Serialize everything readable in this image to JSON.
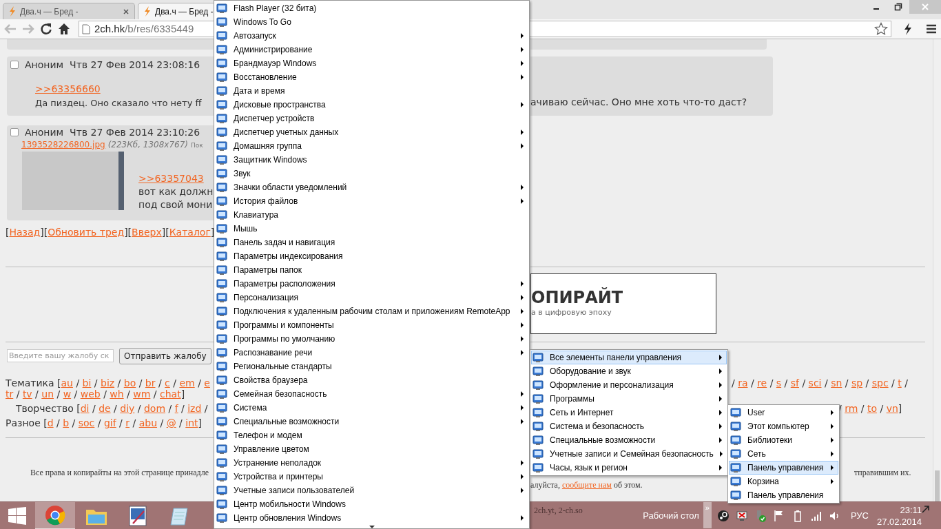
{
  "browser": {
    "tabs": [
      {
        "title": "Два.ч — Бред -",
        "selected": false,
        "closable": true
      },
      {
        "title": "Два.ч — Бред -",
        "selected": true,
        "closable": false
      }
    ],
    "address": {
      "host": "2ch.hk",
      "path": "/b/res/6335449"
    }
  },
  "page": {
    "post_1": {
      "checked": false,
      "author": "Аноним",
      "date": "Чтв 27 Фев 2014 23:08:16",
      "reply_link": ">>63356660",
      "text_left": "Да пиздец. Оно сказало что нету ff",
      "text_right": "ачиваю сейчас. Оно мне хоть что-то даст?"
    },
    "post_2": {
      "checked": false,
      "author": "Аноним",
      "date": "Чтв 27 Фев 2014 23:10:26",
      "file_link": "1393528226800.jpg",
      "file_info": "(223Кб, 1308x767)",
      "file_action": "Пок",
      "reply_link": ">>63357043",
      "text_lines": [
        "вот как должн",
        "под свой мони"
      ]
    },
    "nav": [
      {
        "text": "["
      },
      {
        "link": "Назад"
      },
      {
        "text": "]["
      },
      {
        "link": "Обновить тред"
      },
      {
        "text": "]["
      },
      {
        "link": "Вверх"
      },
      {
        "text": "]["
      },
      {
        "link": "Каталог"
      },
      {
        "text": "]"
      }
    ],
    "ad": {
      "title": "ОПИРАЙТ",
      "subtitle": "а в цифровую эпоху"
    },
    "complaint": {
      "placeholder": "Введите вашу жалобу ск",
      "button": "Отправить жалобу"
    },
    "boards": [
      {
        "left": [
          {
            "text": "Тематика ["
          },
          {
            "link": "au"
          },
          {
            "text": " / "
          },
          {
            "link": "bi"
          },
          {
            "text": " / "
          },
          {
            "link": "biz"
          },
          {
            "text": " / "
          },
          {
            "link": "bo"
          },
          {
            "text": " / "
          },
          {
            "link": "br"
          },
          {
            "text": " / "
          },
          {
            "link": "c"
          },
          {
            "text": " / "
          },
          {
            "link": "em"
          },
          {
            "text": " / "
          },
          {
            "link": "e"
          }
        ],
        "right": [
          {
            "text": "/ "
          },
          {
            "link": "ra"
          },
          {
            "text": " / "
          },
          {
            "link": "re"
          },
          {
            "text": " / "
          },
          {
            "link": "s"
          },
          {
            "text": " / "
          },
          {
            "link": "sf"
          },
          {
            "text": " / "
          },
          {
            "link": "sci"
          },
          {
            "text": " / "
          },
          {
            "link": "sn"
          },
          {
            "text": " / "
          },
          {
            "link": "sp"
          },
          {
            "text": " / "
          },
          {
            "link": "spc"
          },
          {
            "text": " / "
          },
          {
            "link": "t"
          },
          {
            "text": " /"
          }
        ]
      },
      {
        "left": [
          {
            "link": "tr"
          },
          {
            "text": " / "
          },
          {
            "link": "tv"
          },
          {
            "text": " / "
          },
          {
            "link": "un"
          },
          {
            "text": " / "
          },
          {
            "link": "w"
          },
          {
            "text": " / "
          },
          {
            "link": "web"
          },
          {
            "text": " / "
          },
          {
            "link": "wh"
          },
          {
            "text": " / "
          },
          {
            "link": "wm"
          },
          {
            "text": " / "
          },
          {
            "link": "chat"
          },
          {
            "text": "]"
          }
        ]
      },
      {
        "left": [
          {
            "text": "Творчество ["
          },
          {
            "link": "di"
          },
          {
            "text": " / "
          },
          {
            "link": "de"
          },
          {
            "text": " / "
          },
          {
            "link": "diy"
          },
          {
            "text": " / "
          },
          {
            "link": "dom"
          },
          {
            "text": " / "
          },
          {
            "link": "f"
          },
          {
            "text": " / "
          },
          {
            "link": "izd"
          },
          {
            "text": " /"
          }
        ],
        "right": [
          {
            "text": "/ "
          },
          {
            "link": "rm"
          },
          {
            "text": " / "
          },
          {
            "link": "to"
          },
          {
            "text": " / "
          },
          {
            "link": "vn"
          },
          {
            "text": "]"
          }
        ]
      },
      {
        "left": [
          {
            "text": "Разное ["
          },
          {
            "link": "d"
          },
          {
            "text": " / "
          },
          {
            "link": "b"
          },
          {
            "text": " / "
          },
          {
            "link": "soc"
          },
          {
            "text": " / "
          },
          {
            "link": "gif"
          },
          {
            "text": " / "
          },
          {
            "link": "r"
          },
          {
            "text": " / "
          },
          {
            "link": "abu"
          },
          {
            "text": " / "
          },
          {
            "link": "@"
          },
          {
            "text": " / "
          },
          {
            "link": "int"
          },
          {
            "text": "]"
          }
        ]
      }
    ],
    "footer": {
      "left": "Все права и копирайты на этой странице принадле",
      "right_1": "тправившим их.",
      "right_2": [
        {
          "text": "алуйста, "
        },
        {
          "link": "сообщите нам"
        },
        {
          "text": " об этом."
        }
      ],
      "domains": "2ch.yt, 2-ch.so"
    }
  },
  "menus": [
    {
      "items": [
        {
          "label": "Flash Player (32 бита)",
          "submenu": false,
          "selected": false
        },
        {
          "label": "Windows To Go",
          "submenu": false,
          "selected": false
        },
        {
          "label": "Автозапуск",
          "submenu": true,
          "selected": false
        },
        {
          "label": "Администрирование",
          "submenu": true,
          "selected": false
        },
        {
          "label": "Брандмауэр Windows",
          "submenu": true,
          "selected": false
        },
        {
          "label": "Восстановление",
          "submenu": true,
          "selected": false
        },
        {
          "label": "Дата и время",
          "submenu": false,
          "selected": false
        },
        {
          "label": "Дисковые пространства",
          "submenu": true,
          "selected": false
        },
        {
          "label": "Диспетчер устройств",
          "submenu": false,
          "selected": false
        },
        {
          "label": "Диспетчер учетных данных",
          "submenu": true,
          "selected": false
        },
        {
          "label": "Домашняя группа",
          "submenu": true,
          "selected": false
        },
        {
          "label": "Защитник Windows",
          "submenu": false,
          "selected": false
        },
        {
          "label": "Звук",
          "submenu": false,
          "selected": false
        },
        {
          "label": "Значки области уведомлений",
          "submenu": true,
          "selected": false
        },
        {
          "label": "История файлов",
          "submenu": true,
          "selected": false
        },
        {
          "label": "Клавиатура",
          "submenu": false,
          "selected": false
        },
        {
          "label": "Мышь",
          "submenu": false,
          "selected": false
        },
        {
          "label": "Панель задач и навигация",
          "submenu": false,
          "selected": false
        },
        {
          "label": "Параметры индексирования",
          "submenu": false,
          "selected": false
        },
        {
          "label": "Параметры папок",
          "submenu": false,
          "selected": false
        },
        {
          "label": "Параметры расположения",
          "submenu": true,
          "selected": false
        },
        {
          "label": "Персонализация",
          "submenu": true,
          "selected": false
        },
        {
          "label": "Подключения к удаленным рабочим столам и приложениям RemoteApp",
          "submenu": true,
          "selected": false
        },
        {
          "label": "Программы и компоненты",
          "submenu": true,
          "selected": false
        },
        {
          "label": "Программы по умолчанию",
          "submenu": true,
          "selected": false
        },
        {
          "label": "Распознавание речи",
          "submenu": true,
          "selected": false
        },
        {
          "label": "Региональные стандарты",
          "submenu": false,
          "selected": false
        },
        {
          "label": "Свойства браузера",
          "submenu": false,
          "selected": false
        },
        {
          "label": "Семейная безопасность",
          "submenu": true,
          "selected": false
        },
        {
          "label": "Система",
          "submenu": true,
          "selected": false
        },
        {
          "label": "Специальные возможности",
          "submenu": true,
          "selected": false
        },
        {
          "label": "Телефон и модем",
          "submenu": false,
          "selected": false
        },
        {
          "label": "Управление цветом",
          "submenu": false,
          "selected": false
        },
        {
          "label": "Устранение неполадок",
          "submenu": true,
          "selected": false
        },
        {
          "label": "Устройства и принтеры",
          "submenu": true,
          "selected": false
        },
        {
          "label": "Учетные записи пользователей",
          "submenu": true,
          "selected": false
        },
        {
          "label": "Центр мобильности Windows",
          "submenu": false,
          "selected": false
        },
        {
          "label": "Центр обновления Windows",
          "submenu": true,
          "selected": false
        }
      ]
    },
    {
      "items": [
        {
          "label": "Все элементы панели управления",
          "submenu": true,
          "selected": true
        },
        {
          "label": "Оборудование и звук",
          "submenu": true,
          "selected": false
        },
        {
          "label": "Оформление и персонализация",
          "submenu": true,
          "selected": false
        },
        {
          "label": "Программы",
          "submenu": true,
          "selected": false
        },
        {
          "label": "Сеть и Интернет",
          "submenu": true,
          "selected": false
        },
        {
          "label": "Система и безопасность",
          "submenu": true,
          "selected": false
        },
        {
          "label": "Специальные возможности",
          "submenu": true,
          "selected": false
        },
        {
          "label": "Учетные записи и Семейная безопасность",
          "submenu": true,
          "selected": false
        },
        {
          "label": "Часы, язык и регион",
          "submenu": true,
          "selected": false
        }
      ]
    },
    {
      "items": [
        {
          "label": "User",
          "submenu": true,
          "selected": false
        },
        {
          "label": "Этот компьютер",
          "submenu": true,
          "selected": false
        },
        {
          "label": "Библиотеки",
          "submenu": true,
          "selected": false
        },
        {
          "label": "Сеть",
          "submenu": true,
          "selected": false
        },
        {
          "label": "Панель управления",
          "submenu": true,
          "selected": true
        },
        {
          "label": "Корзина",
          "submenu": true,
          "selected": false
        },
        {
          "label": "Панель управления",
          "submenu": false,
          "selected": false
        }
      ]
    }
  ],
  "taskbar": {
    "apps": [
      {
        "kind": "browser",
        "selected": true
      },
      {
        "kind": "files",
        "selected": false
      },
      {
        "kind": "paint",
        "selected": false
      },
      {
        "kind": "notepad",
        "selected": false
      }
    ],
    "toolbar_label": "Рабочий стол",
    "toolbar_toggle": "»",
    "language": "РУС",
    "time": "23:11",
    "date": "27.02.2014"
  }
}
